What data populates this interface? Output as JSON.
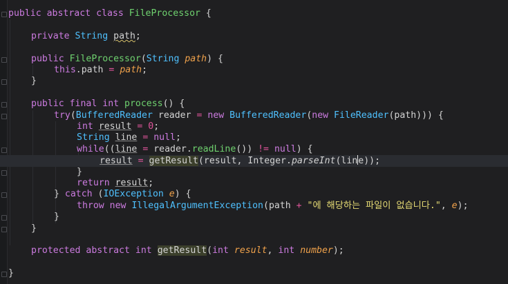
{
  "editor": {
    "lines": [
      {
        "indent": 0,
        "tokens": [
          {
            "t": "public",
            "c": "kw"
          },
          {
            "t": " "
          },
          {
            "t": "abstract",
            "c": "kw"
          },
          {
            "t": " "
          },
          {
            "t": "class",
            "c": "kw"
          },
          {
            "t": " "
          },
          {
            "t": "FileProcessor",
            "c": "fn"
          },
          {
            "t": " {"
          }
        ]
      },
      {
        "indent": 0,
        "tokens": []
      },
      {
        "indent": 1,
        "tokens": [
          {
            "t": "private",
            "c": "kw"
          },
          {
            "t": " "
          },
          {
            "t": "String",
            "c": "ty"
          },
          {
            "t": " "
          },
          {
            "t": "path",
            "c": "wavy"
          },
          {
            "t": ";"
          }
        ]
      },
      {
        "indent": 0,
        "tokens": []
      },
      {
        "indent": 1,
        "tokens": [
          {
            "t": "public",
            "c": "kw"
          },
          {
            "t": " "
          },
          {
            "t": "FileProcessor",
            "c": "fn"
          },
          {
            "t": "("
          },
          {
            "t": "String",
            "c": "ty"
          },
          {
            "t": " "
          },
          {
            "t": "path",
            "c": "par"
          },
          {
            "t": ") {"
          }
        ]
      },
      {
        "indent": 2,
        "tokens": [
          {
            "t": "this",
            "c": "kw"
          },
          {
            "t": ".path "
          },
          {
            "t": "=",
            "c": "op"
          },
          {
            "t": " "
          },
          {
            "t": "path",
            "c": "par"
          },
          {
            "t": ";"
          }
        ]
      },
      {
        "indent": 1,
        "tokens": [
          {
            "t": "}"
          }
        ]
      },
      {
        "indent": 0,
        "tokens": []
      },
      {
        "indent": 1,
        "tokens": [
          {
            "t": "public",
            "c": "kw"
          },
          {
            "t": " "
          },
          {
            "t": "final",
            "c": "kw"
          },
          {
            "t": " "
          },
          {
            "t": "int",
            "c": "kw"
          },
          {
            "t": " "
          },
          {
            "t": "process",
            "c": "fn"
          },
          {
            "t": "() {"
          }
        ]
      },
      {
        "indent": 2,
        "tokens": [
          {
            "t": "try",
            "c": "kw"
          },
          {
            "t": "("
          },
          {
            "t": "BufferedReader",
            "c": "ty"
          },
          {
            "t": " reader "
          },
          {
            "t": "=",
            "c": "op"
          },
          {
            "t": " "
          },
          {
            "t": "new",
            "c": "kw"
          },
          {
            "t": " "
          },
          {
            "t": "BufferedReader",
            "c": "ty"
          },
          {
            "t": "("
          },
          {
            "t": "new",
            "c": "kw"
          },
          {
            "t": " "
          },
          {
            "t": "FileReader",
            "c": "ty"
          },
          {
            "t": "(path))) {"
          }
        ]
      },
      {
        "indent": 3,
        "tokens": [
          {
            "t": "int",
            "c": "kw"
          },
          {
            "t": " "
          },
          {
            "t": "result",
            "c": "uline"
          },
          {
            "t": " "
          },
          {
            "t": "=",
            "c": "op"
          },
          {
            "t": " "
          },
          {
            "t": "0",
            "c": "nb"
          },
          {
            "t": ";"
          }
        ]
      },
      {
        "indent": 3,
        "tokens": [
          {
            "t": "String",
            "c": "ty"
          },
          {
            "t": " "
          },
          {
            "t": "line",
            "c": "uline"
          },
          {
            "t": " "
          },
          {
            "t": "=",
            "c": "op"
          },
          {
            "t": " "
          },
          {
            "t": "null",
            "c": "kw"
          },
          {
            "t": ";"
          }
        ]
      },
      {
        "indent": 3,
        "tokens": [
          {
            "t": "while",
            "c": "kw"
          },
          {
            "t": "(("
          },
          {
            "t": "line",
            "c": "uline"
          },
          {
            "t": " "
          },
          {
            "t": "=",
            "c": "op"
          },
          {
            "t": " reader."
          },
          {
            "t": "readLine",
            "c": "fn"
          },
          {
            "t": "()) "
          },
          {
            "t": "!=",
            "c": "op"
          },
          {
            "t": " "
          },
          {
            "t": "null",
            "c": "kw"
          },
          {
            "t": ") {"
          }
        ]
      },
      {
        "indent": 4,
        "current": true,
        "tokens": [
          {
            "t": "result",
            "c": "uline"
          },
          {
            "t": " "
          },
          {
            "t": "=",
            "c": "op"
          },
          {
            "t": " "
          },
          {
            "t": "getResult",
            "c": "hl"
          },
          {
            "t": "(result, Integer."
          },
          {
            "t": "parseInt",
            "c": "it"
          },
          {
            "t": "(li"
          },
          {
            "t": "ne",
            "c": "caretafter"
          },
          {
            "t": "));"
          }
        ]
      },
      {
        "indent": 3,
        "tokens": [
          {
            "t": "}"
          }
        ]
      },
      {
        "indent": 3,
        "tokens": [
          {
            "t": "return",
            "c": "kw"
          },
          {
            "t": " "
          },
          {
            "t": "result",
            "c": "uline"
          },
          {
            "t": ";"
          }
        ]
      },
      {
        "indent": 2,
        "tokens": [
          {
            "t": "} "
          },
          {
            "t": "catch",
            "c": "kw"
          },
          {
            "t": " ("
          },
          {
            "t": "IOException",
            "c": "ty"
          },
          {
            "t": " "
          },
          {
            "t": "e",
            "c": "par"
          },
          {
            "t": ") {"
          }
        ]
      },
      {
        "indent": 3,
        "tokens": [
          {
            "t": "throw",
            "c": "kw"
          },
          {
            "t": " "
          },
          {
            "t": "new",
            "c": "kw"
          },
          {
            "t": " "
          },
          {
            "t": "IllegalArgumentException",
            "c": "ty"
          },
          {
            "t": "(path "
          },
          {
            "t": "+",
            "c": "op"
          },
          {
            "t": " "
          },
          {
            "t": "\"에 해당하는 파일이 없습니다.\"",
            "c": "st"
          },
          {
            "t": ", "
          },
          {
            "t": "e",
            "c": "par"
          },
          {
            "t": ");"
          }
        ]
      },
      {
        "indent": 2,
        "tokens": [
          {
            "t": "}"
          }
        ]
      },
      {
        "indent": 1,
        "tokens": [
          {
            "t": "}"
          }
        ]
      },
      {
        "indent": 0,
        "tokens": []
      },
      {
        "indent": 1,
        "tokens": [
          {
            "t": "protected",
            "c": "kw"
          },
          {
            "t": " "
          },
          {
            "t": "abstract",
            "c": "kw"
          },
          {
            "t": " "
          },
          {
            "t": "int",
            "c": "kw"
          },
          {
            "t": " "
          },
          {
            "t": "getResult",
            "c": "hl"
          },
          {
            "t": "("
          },
          {
            "t": "int",
            "c": "kw"
          },
          {
            "t": " "
          },
          {
            "t": "result",
            "c": "par"
          },
          {
            "t": ", "
          },
          {
            "t": "int",
            "c": "kw"
          },
          {
            "t": " "
          },
          {
            "t": "number",
            "c": "par"
          },
          {
            "t": ");"
          }
        ]
      },
      {
        "indent": 0,
        "tokens": []
      },
      {
        "indent": 0,
        "tokens": [
          {
            "t": "}"
          }
        ]
      }
    ]
  }
}
